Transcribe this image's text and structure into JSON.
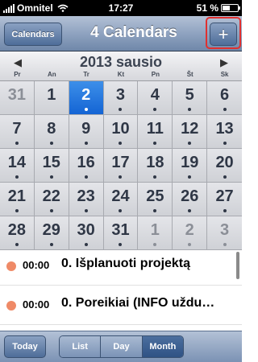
{
  "status_bar": {
    "carrier": "Omnitel",
    "time": "17:27",
    "battery": "51 %",
    "battery_level": 0.51
  },
  "nav": {
    "calendars_button": "Calendars",
    "title": "4 Calendars",
    "add_button": "+"
  },
  "month": {
    "title": "2013 sausio",
    "prev_arrow": "◀",
    "next_arrow": "▶",
    "weekdays": [
      "Pr",
      "An",
      "Tr",
      "Kt",
      "Pn",
      "Št",
      "Sk"
    ],
    "days": [
      {
        "n": "31",
        "other": true,
        "dot": false
      },
      {
        "n": "1",
        "other": false,
        "dot": false
      },
      {
        "n": "2",
        "other": false,
        "dot": true,
        "selected": true
      },
      {
        "n": "3",
        "other": false,
        "dot": true
      },
      {
        "n": "4",
        "other": false,
        "dot": true
      },
      {
        "n": "5",
        "other": false,
        "dot": true
      },
      {
        "n": "6",
        "other": false,
        "dot": true
      },
      {
        "n": "7",
        "other": false,
        "dot": true
      },
      {
        "n": "8",
        "other": false,
        "dot": true
      },
      {
        "n": "9",
        "other": false,
        "dot": true
      },
      {
        "n": "10",
        "other": false,
        "dot": true
      },
      {
        "n": "11",
        "other": false,
        "dot": true
      },
      {
        "n": "12",
        "other": false,
        "dot": true
      },
      {
        "n": "13",
        "other": false,
        "dot": true
      },
      {
        "n": "14",
        "other": false,
        "dot": true
      },
      {
        "n": "15",
        "other": false,
        "dot": true
      },
      {
        "n": "16",
        "other": false,
        "dot": true
      },
      {
        "n": "17",
        "other": false,
        "dot": true
      },
      {
        "n": "18",
        "other": false,
        "dot": true
      },
      {
        "n": "19",
        "other": false,
        "dot": true
      },
      {
        "n": "20",
        "other": false,
        "dot": true
      },
      {
        "n": "21",
        "other": false,
        "dot": true
      },
      {
        "n": "22",
        "other": false,
        "dot": true
      },
      {
        "n": "23",
        "other": false,
        "dot": true
      },
      {
        "n": "24",
        "other": false,
        "dot": true
      },
      {
        "n": "25",
        "other": false,
        "dot": true
      },
      {
        "n": "26",
        "other": false,
        "dot": true
      },
      {
        "n": "27",
        "other": false,
        "dot": true
      },
      {
        "n": "28",
        "other": false,
        "dot": true
      },
      {
        "n": "29",
        "other": false,
        "dot": true
      },
      {
        "n": "30",
        "other": false,
        "dot": true
      },
      {
        "n": "31",
        "other": false,
        "dot": true
      },
      {
        "n": "1",
        "other": true,
        "dot": true
      },
      {
        "n": "2",
        "other": true,
        "dot": true
      },
      {
        "n": "3",
        "other": true,
        "dot": true
      }
    ]
  },
  "events": [
    {
      "time": "00:00",
      "title": "0. Išplanuoti projektą",
      "color": "#ef8a67"
    },
    {
      "time": "00:00",
      "title": "0. Poreikiai (INFO uždu…",
      "color": "#ef8a67"
    }
  ],
  "toolbar": {
    "today": "Today",
    "views": [
      "List",
      "Day",
      "Month"
    ],
    "active_view": "Month"
  },
  "colors": {
    "selected_day": "#1464d4",
    "add_highlight": "#e0302f"
  }
}
